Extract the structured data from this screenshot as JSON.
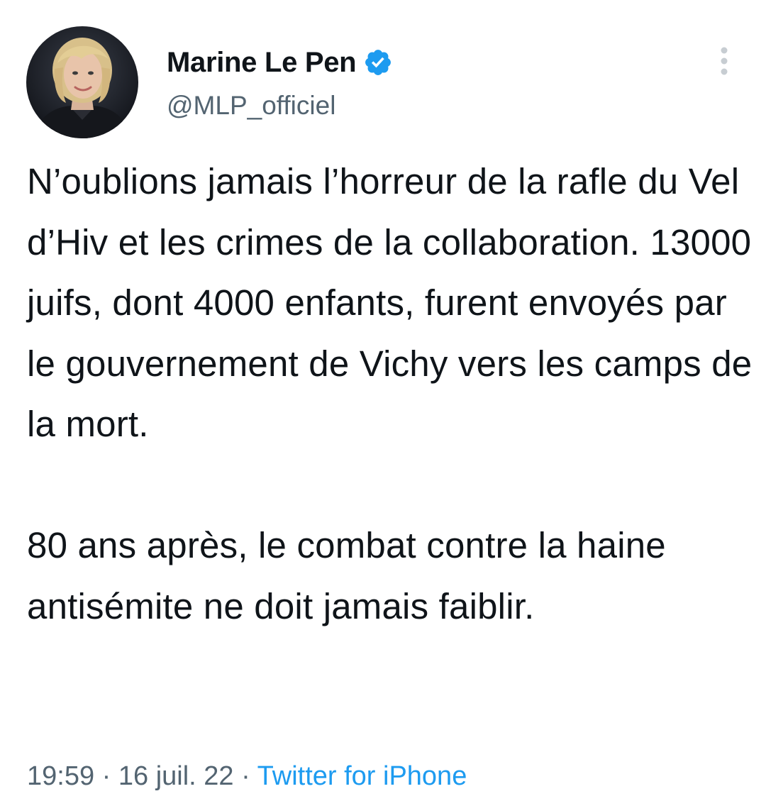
{
  "author": {
    "display_name": "Marine Le Pen",
    "handle": "@MLP_officiel",
    "verified": true,
    "avatar_icon": "profile-photo"
  },
  "menu": {
    "icon": "more-vertical-icon"
  },
  "tweet": {
    "text": "N’oublions jamais l’horreur de la rafle du Vel d’Hiv et les crimes de la collaboration. 13000 juifs, dont 4000 enfants, furent envoyés par le gouvernement de Vichy vers les camps de la mort.\n\n80 ans après, le combat contre la haine antisémite ne doit jamais faiblir."
  },
  "meta": {
    "time": "19:59",
    "separator1": " · ",
    "date": "16 juil. 22",
    "separator2": " · ",
    "source": "Twitter for iPhone"
  },
  "colors": {
    "text": "#0f1419",
    "secondary": "#536471",
    "accent": "#1d9bf0",
    "background": "#ffffff"
  }
}
